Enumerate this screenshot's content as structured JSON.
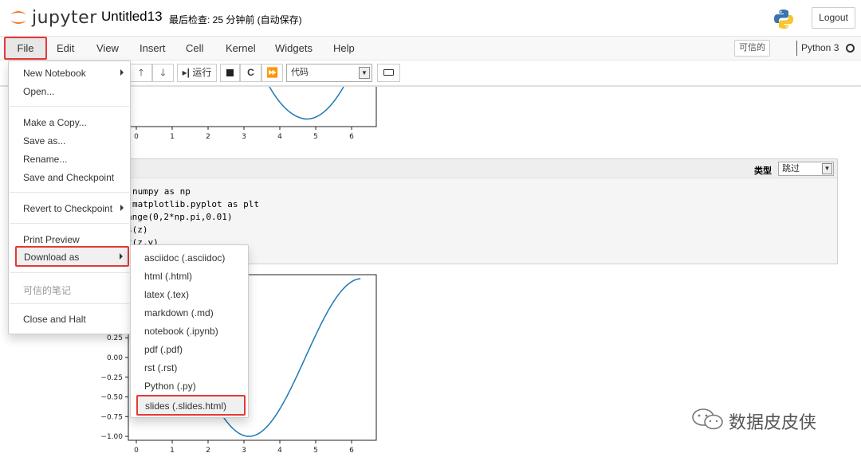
{
  "header": {
    "logo_text": "jupyter",
    "notebook_title": "Untitled13",
    "checkpoint_status": "最后检查: 25 分钟前 (自动保存)",
    "logout_label": "Logout"
  },
  "menubar": {
    "items": [
      "File",
      "Edit",
      "View",
      "Insert",
      "Cell",
      "Kernel",
      "Widgets",
      "Help"
    ],
    "trusted_label": "可信的",
    "kernel_name": "Python 3"
  },
  "toolbar": {
    "run_label": "运行",
    "cell_type": "代码"
  },
  "file_menu": {
    "items": [
      "New Notebook",
      "Open...",
      "Make a Copy...",
      "Save as...",
      "Rename...",
      "Save and Checkpoint",
      "Revert to Checkpoint",
      "Print Preview",
      "Download as",
      "可信的笔记",
      "Close and Halt"
    ]
  },
  "download_menu": {
    "items": [
      "asciidoc (.asciidoc)",
      "html (.html)",
      "latex (.tex)",
      "markdown (.md)",
      "notebook (.ipynb)",
      "pdf (.pdf)",
      "rst (.rst)",
      "Python (.py)",
      "slides (.slides.html)"
    ]
  },
  "cell2": {
    "type_label": "类型",
    "type_value": "跳过",
    "code_lines": [
      "numpy as np",
      "matplotlib.pyplot as plt",
      "ange(0,2*np.pi,0.01)",
      "s(z)",
      "t(z,y)"
    ]
  },
  "plot_top": {
    "x_ticks": [
      "0",
      "1",
      "2",
      "3",
      "4",
      "5",
      "6"
    ]
  },
  "plot_bottom": {
    "x_ticks": [
      "0",
      "1",
      "2",
      "3",
      "4",
      "5",
      "6"
    ],
    "y_ticks": [
      "0.25",
      "0.00",
      "−0.25",
      "−0.50",
      "−0.75",
      "−1.00"
    ]
  },
  "watermark": {
    "text": "数据皮皮侠"
  },
  "colors": {
    "highlight": "#e53935",
    "plot_line": "#1f77b4"
  }
}
